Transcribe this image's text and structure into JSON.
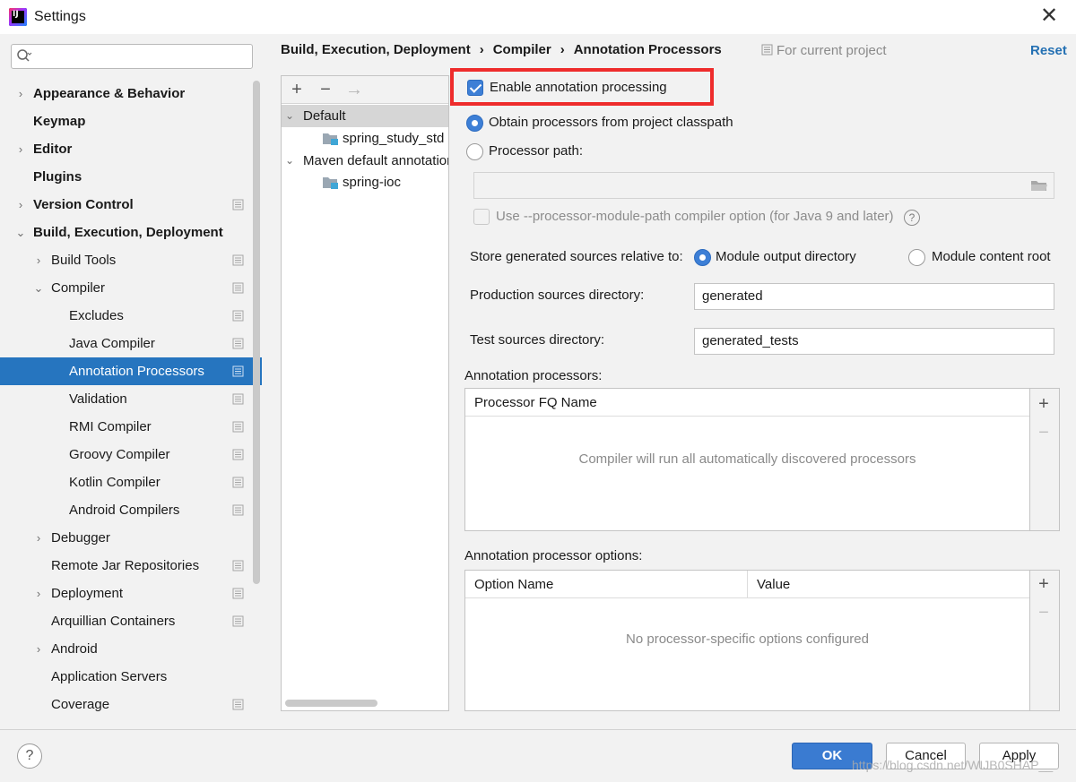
{
  "window": {
    "title": "Settings",
    "close_glyph": "✕"
  },
  "sidebar": {
    "search": {
      "placeholder": "",
      "icon": "search-icon"
    },
    "items": [
      {
        "label": "Appearance & Behavior",
        "bold": true,
        "arrow": "›"
      },
      {
        "label": "Keymap",
        "bold": true,
        "arrow": ""
      },
      {
        "label": "Editor",
        "bold": true,
        "arrow": "›"
      },
      {
        "label": "Plugins",
        "bold": true,
        "arrow": ""
      },
      {
        "label": "Version Control",
        "bold": true,
        "arrow": "›"
      },
      {
        "label": "Build, Execution, Deployment",
        "bold": true,
        "arrow": "⌄"
      },
      {
        "label": "Build Tools",
        "bold": false,
        "arrow": "›"
      },
      {
        "label": "Compiler",
        "bold": false,
        "arrow": "⌄"
      },
      {
        "label": "Excludes",
        "bold": false,
        "arrow": ""
      },
      {
        "label": "Java Compiler",
        "bold": false,
        "arrow": ""
      },
      {
        "label": "Annotation Processors",
        "bold": false,
        "arrow": "",
        "selected": true
      },
      {
        "label": "Validation",
        "bold": false,
        "arrow": ""
      },
      {
        "label": "RMI Compiler",
        "bold": false,
        "arrow": ""
      },
      {
        "label": "Groovy Compiler",
        "bold": false,
        "arrow": ""
      },
      {
        "label": "Kotlin Compiler",
        "bold": false,
        "arrow": ""
      },
      {
        "label": "Android Compilers",
        "bold": false,
        "arrow": ""
      },
      {
        "label": "Debugger",
        "bold": false,
        "arrow": "›"
      },
      {
        "label": "Remote Jar Repositories",
        "bold": false,
        "arrow": ""
      },
      {
        "label": "Deployment",
        "bold": false,
        "arrow": "›"
      },
      {
        "label": "Arquillian Containers",
        "bold": false,
        "arrow": ""
      },
      {
        "label": "Android",
        "bold": false,
        "arrow": "›"
      },
      {
        "label": "Application Servers",
        "bold": false,
        "arrow": ""
      },
      {
        "label": "Coverage",
        "bold": false,
        "arrow": ""
      }
    ]
  },
  "breadcrumb": {
    "items": [
      "Build, Execution, Deployment",
      "Compiler",
      "Annotation Processors"
    ],
    "separator": "›"
  },
  "scope_label": "For current project",
  "reset_label": "Reset",
  "profiles": {
    "toolbar": {
      "add": "+",
      "remove": "−",
      "move": "→"
    },
    "tree": [
      {
        "label": "Default",
        "arrow": "⌄",
        "type": "group",
        "selected": true
      },
      {
        "label": "spring_study_std",
        "arrow": "",
        "type": "module"
      },
      {
        "label": "Maven default annotation processors profile",
        "arrow": "⌄",
        "type": "group"
      },
      {
        "label": "spring-ioc",
        "arrow": "",
        "type": "module"
      }
    ]
  },
  "settings": {
    "enable_annotation_processing": {
      "label": "Enable annotation processing",
      "checked": true
    },
    "obtain_from_classpath": {
      "label": "Obtain processors from project classpath",
      "selected": true
    },
    "processor_path": {
      "label": "Processor path:",
      "selected": false,
      "value": ""
    },
    "module_path_option": {
      "label": "Use --processor-module-path compiler option (for Java 9 and later)",
      "checked": false,
      "enabled": false
    },
    "store_generated": {
      "label": "Store generated sources relative to:",
      "options": [
        {
          "label": "Module output directory",
          "selected": true
        },
        {
          "label": "Module content root",
          "selected": false
        }
      ]
    },
    "production_dir": {
      "label": "Production sources directory:",
      "value": "generated"
    },
    "test_dir": {
      "label": "Test sources directory:",
      "value": "generated_tests"
    },
    "processors_table": {
      "title": "Annotation processors:",
      "columns": [
        "Processor FQ Name"
      ],
      "empty_text": "Compiler will run all automatically discovered processors"
    },
    "options_table": {
      "title": "Annotation processor options:",
      "columns": [
        "Option Name",
        "Value"
      ],
      "empty_text": "No processor-specific options configured"
    }
  },
  "buttons": {
    "ok": "OK",
    "cancel": "Cancel",
    "apply": "Apply",
    "help": "?"
  },
  "watermark": "https://blog.csdn.net/WIJB0SHAP__",
  "colors": {
    "selection": "#2675bf",
    "primary_button": "#3a7bd1",
    "link": "#2470b3",
    "highlight": "#ee2c2c"
  }
}
